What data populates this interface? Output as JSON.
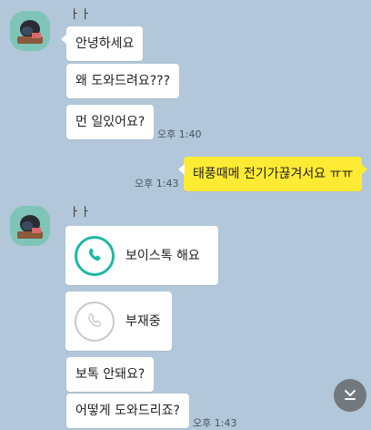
{
  "sender_name": "ㅏㅏ",
  "colors": {
    "background": "#b2c7d9",
    "my_bubble": "#ffeb33",
    "their_bubble": "#ffffff",
    "voice_call_accent": "#1fb8a5",
    "missed_call_gray": "#c8c8c8"
  },
  "group1": {
    "messages": [
      "안녕하세요",
      "왜 도와드려요???",
      "먼 일있어요?"
    ],
    "time": "오후 1:40"
  },
  "my_message": {
    "text": "태풍때메 전기가끊겨서요 ㅠㅠ",
    "time": "오후 1:43"
  },
  "group2": {
    "voice_call": {
      "label": "보이스톡 해요",
      "icon": "phone-icon"
    },
    "missed_call": {
      "label": "부재중",
      "icon": "phone-icon"
    },
    "messages": [
      "보톡 안돼요?",
      "어떻게 도와드리죠?"
    ],
    "time": "오후 1:43"
  },
  "scroll_button_icon": "chevrons-down-icon"
}
